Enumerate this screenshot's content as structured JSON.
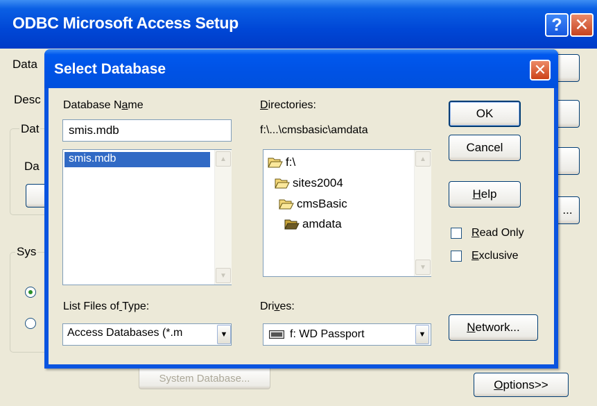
{
  "background_window": {
    "title": "ODBC Microsoft Access Setup",
    "help_label": "?",
    "close_label": "✕",
    "label_data": "Data",
    "label_desc": "Desc",
    "label_data2": "Dat",
    "label_data3": "Da",
    "label_sys": "Sys",
    "system_database_button": "System Database...",
    "options_button": "Options>>",
    "ellipsis": "..."
  },
  "dialog": {
    "title": "Select Database",
    "close_label": "✕",
    "database_name_label": "Database Name",
    "database_name_value": "smis.mdb",
    "file_list": [
      "smis.mdb"
    ],
    "directories_label": "Directories:",
    "current_path": "f:\\...\\cmsbasic\\amdata",
    "directory_tree": [
      {
        "name": "f:\\",
        "open": true
      },
      {
        "name": "sites2004",
        "open": true
      },
      {
        "name": "cmsBasic",
        "open": true
      },
      {
        "name": "amdata",
        "open": true
      }
    ],
    "ok_button": "OK",
    "cancel_button": "Cancel",
    "help_button": "Help",
    "read_only_label": "Read Only",
    "exclusive_label": "Exclusive",
    "list_files_type_label": "List Files of Type:",
    "list_files_type_value": "Access Databases (*.m",
    "drives_label": "Drives:",
    "drives_value": "f: WD Passport",
    "network_button": "Network..."
  }
}
